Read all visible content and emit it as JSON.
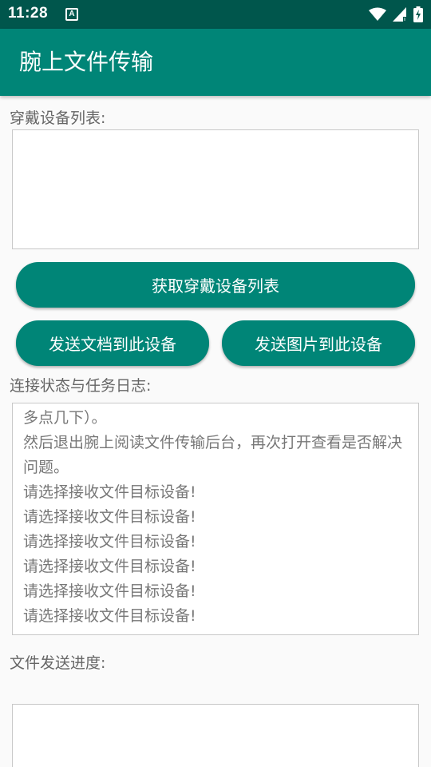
{
  "status_bar": {
    "time": "11:28",
    "notification_glyph": "A",
    "icons": [
      "wifi-icon",
      "cell-signal-icon",
      "battery-charging-icon"
    ]
  },
  "app_bar": {
    "title": "腕上文件传输"
  },
  "devices": {
    "label": "穿戴设备列表:",
    "items": []
  },
  "buttons": {
    "get_devices": "获取穿戴设备列表",
    "send_document": "发送文档到此设备",
    "send_image": "发送图片到此设备"
  },
  "log": {
    "label": "连接状态与任务日志:",
    "lines": [
      "多点几下）。",
      "然后退出腕上阅读文件传输后台，再次打开查看是否解决问题。",
      "请选择接收文件目标设备!",
      "请选择接收文件目标设备!",
      "请选择接收文件目标设备!",
      "请选择接收文件目标设备!",
      "请选择接收文件目标设备!",
      "请选择接收文件目标设备!"
    ]
  },
  "progress": {
    "label": "文件发送进度:"
  },
  "colors": {
    "status_bar": "#00564c",
    "primary": "#008577"
  }
}
